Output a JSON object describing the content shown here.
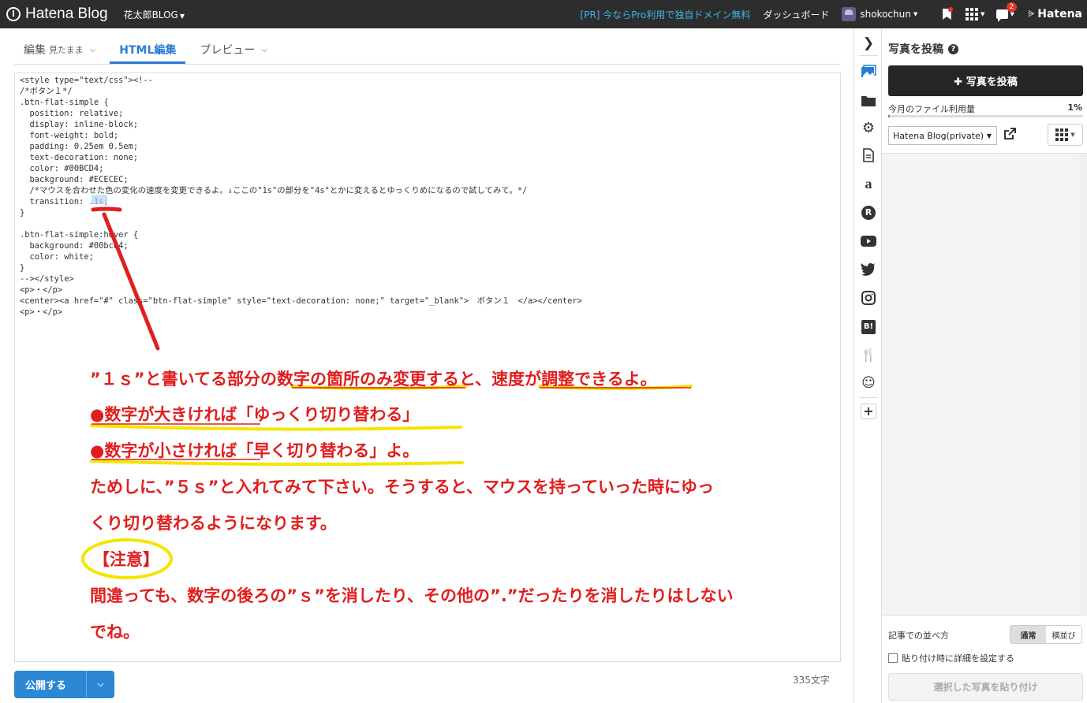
{
  "topbar": {
    "logo_text": "Hatena Blog",
    "blog_name": "花太郎BLOG",
    "pr_link": "[PR] 今ならPro利用で独自ドメイン無料",
    "dashboard": "ダッシュボード",
    "username": "shokochun",
    "notification_count": "2",
    "hatena": "Hatena"
  },
  "tabs": {
    "edit": "編集",
    "edit_mode": "見たまま",
    "html_edit": "HTML編集",
    "preview": "プレビュー"
  },
  "code_lines": [
    "<style type=\"text/css\"><!--",
    "/*ボタン１*/",
    ".btn-flat-simple {",
    "  position: relative;",
    "  display: inline-block;",
    "  font-weight: bold;",
    "  padding: 0.25em 0.5em;",
    "  text-decoration: none;",
    "  color: #00BCD4;",
    "  background: #ECECEC;",
    "  /*マウスを合わせた色の変化の速度を変更できるよ。↓ここの\"1s\"の部分を\"4s\"とかに変えるとゆっくりめになるので試してみて。*/",
    "  transition: .1s;",
    "}",
    "",
    ".btn-flat-simple:hover {",
    "  background: #00bcd4;",
    "  color: white;",
    "}",
    "--></style>",
    "<p>・</p>",
    "<center><a href=\"#\" class=\"btn-flat-simple\" style=\"text-decoration: none;\" target=\"_blank\">　ボタン１　</a></center>",
    "<p>・</p>"
  ],
  "notes": [
    "”１ｓ”と書いてる部分の数字の箇所のみ変更すると、速度が調整できるよ。",
    "●数字が大きければ「ゆっくり切り替わる」",
    "●数字が小さければ「早く切り替わる」よ。",
    "ためしに、”５ｓ”と入れてみて下さい。そうすると、マウスを持っていった時にゆっ",
    "くり切り替わるようになります。",
    "【注意】",
    "間違っても、数字の後ろの”ｓ”を消したり、その他の”.”だったりを消したりはしない",
    "でね。"
  ],
  "publish": {
    "label": "公開する",
    "char_count": "335文字"
  },
  "panel": {
    "title": "写真を投稿",
    "post_button": "✚ 写真を投稿",
    "usage_label": "今月のファイル利用量",
    "usage_pct": "1%",
    "usage_value": 1,
    "blog_select": "Hatena Blog(private)",
    "sort_label": "記事での並べ方",
    "sort_normal": "通常",
    "sort_horizontal": "横並び",
    "detail_checkbox": "貼り付け時に詳細を設定する",
    "paste_button": "選択した写真を貼り付け"
  },
  "colors": {
    "annotation_red": "#e01e1e",
    "annotation_yellow": "#f5e400",
    "accent_blue": "#2c7bd6"
  }
}
